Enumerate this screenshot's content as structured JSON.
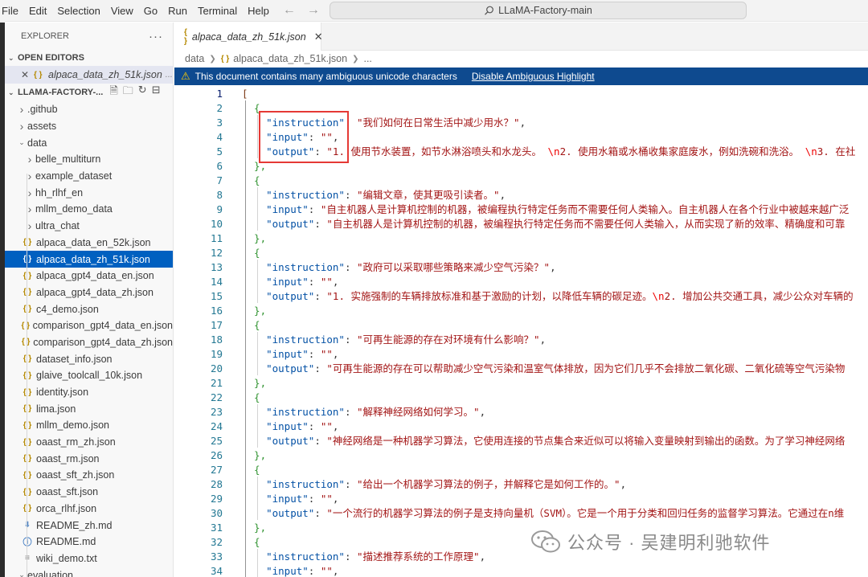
{
  "menu": [
    "File",
    "Edit",
    "Selection",
    "View",
    "Go",
    "Run",
    "Terminal",
    "Help"
  ],
  "command_center": "LLaMA-Factory-main",
  "explorer": {
    "title": "EXPLORER",
    "open_editors_label": "OPEN EDITORS",
    "open_editor": {
      "name": "alpaca_data_zh_51k.json",
      "path": "..."
    },
    "project_label": "LLAMA-FACTORY-...",
    "tree": [
      {
        "label": ".github",
        "kind": "folder",
        "level": 0
      },
      {
        "label": "assets",
        "kind": "folder",
        "level": 0
      },
      {
        "label": "data",
        "kind": "folder-open",
        "level": 0
      },
      {
        "label": "belle_multiturn",
        "kind": "folder",
        "level": 1
      },
      {
        "label": "example_dataset",
        "kind": "folder",
        "level": 1
      },
      {
        "label": "hh_rlhf_en",
        "kind": "folder",
        "level": 1
      },
      {
        "label": "mllm_demo_data",
        "kind": "folder",
        "level": 1
      },
      {
        "label": "ultra_chat",
        "kind": "folder",
        "level": 1
      },
      {
        "label": "alpaca_data_en_52k.json",
        "kind": "json",
        "level": 1
      },
      {
        "label": "alpaca_data_zh_51k.json",
        "kind": "json",
        "level": 1,
        "selected": true
      },
      {
        "label": "alpaca_gpt4_data_en.json",
        "kind": "json",
        "level": 1
      },
      {
        "label": "alpaca_gpt4_data_zh.json",
        "kind": "json",
        "level": 1
      },
      {
        "label": "c4_demo.json",
        "kind": "json",
        "level": 1
      },
      {
        "label": "comparison_gpt4_data_en.json",
        "kind": "json",
        "level": 1
      },
      {
        "label": "comparison_gpt4_data_zh.json",
        "kind": "json",
        "level": 1
      },
      {
        "label": "dataset_info.json",
        "kind": "json",
        "level": 1
      },
      {
        "label": "glaive_toolcall_10k.json",
        "kind": "json",
        "level": 1
      },
      {
        "label": "identity.json",
        "kind": "json",
        "level": 1
      },
      {
        "label": "lima.json",
        "kind": "json",
        "level": 1
      },
      {
        "label": "mllm_demo.json",
        "kind": "json",
        "level": 1
      },
      {
        "label": "oaast_rm_zh.json",
        "kind": "json",
        "level": 1
      },
      {
        "label": "oaast_rm.json",
        "kind": "json",
        "level": 1
      },
      {
        "label": "oaast_sft_zh.json",
        "kind": "json",
        "level": 1
      },
      {
        "label": "oaast_sft.json",
        "kind": "json",
        "level": 1
      },
      {
        "label": "orca_rlhf.json",
        "kind": "json",
        "level": 1
      },
      {
        "label": "README_zh.md",
        "kind": "md",
        "level": 1
      },
      {
        "label": "README.md",
        "kind": "info",
        "level": 1
      },
      {
        "label": "wiki_demo.txt",
        "kind": "txt",
        "level": 1
      },
      {
        "label": "evaluation",
        "kind": "folder-open",
        "level": 0
      }
    ]
  },
  "tab": {
    "name": "alpaca_data_zh_51k.json"
  },
  "breadcrumb": {
    "folder": "data",
    "file": "alpaca_data_zh_51k.json",
    "more": "..."
  },
  "banner": {
    "message": "This document contains many ambiguous unicode characters",
    "link": "Disable Ambiguous Highlight"
  },
  "code_lines": [
    {
      "n": "1",
      "parts": [
        [
          "brk2",
          "["
        ]
      ]
    },
    {
      "n": "2",
      "parts": [
        [
          "brk",
          "  {"
        ]
      ]
    },
    {
      "n": "3",
      "parts": [
        [
          "punc",
          "    "
        ],
        [
          "key",
          "\"instruction\""
        ],
        [
          "punc",
          ": "
        ],
        [
          "str",
          "\"我们如何在日常生活中减少用水？\""
        ],
        [
          "punc",
          ","
        ]
      ]
    },
    {
      "n": "4",
      "parts": [
        [
          "punc",
          "    "
        ],
        [
          "key",
          "\"input\""
        ],
        [
          "punc",
          ": "
        ],
        [
          "str",
          "\"\""
        ],
        [
          "punc",
          ","
        ]
      ]
    },
    {
      "n": "5",
      "parts": [
        [
          "punc",
          "    "
        ],
        [
          "key",
          "\"output\""
        ],
        [
          "punc",
          ": "
        ],
        [
          "str",
          "\"1. 使用节水装置，如节水淋浴喷头和水龙头。 "
        ],
        [
          "esc",
          "\\n"
        ],
        [
          "str",
          "2. 使用水箱或水桶收集家庭废水，例如洗碗和洗浴。 "
        ],
        [
          "esc",
          "\\n"
        ],
        [
          "str",
          "3. 在社"
        ]
      ]
    },
    {
      "n": "6",
      "parts": [
        [
          "brk",
          "  },"
        ]
      ]
    },
    {
      "n": "7",
      "parts": [
        [
          "brk",
          "  {"
        ]
      ]
    },
    {
      "n": "8",
      "parts": [
        [
          "punc",
          "    "
        ],
        [
          "key",
          "\"instruction\""
        ],
        [
          "punc",
          ": "
        ],
        [
          "str",
          "\"编辑文章，使其更吸引读者。\""
        ],
        [
          "punc",
          ","
        ]
      ]
    },
    {
      "n": "9",
      "parts": [
        [
          "punc",
          "    "
        ],
        [
          "key",
          "\"input\""
        ],
        [
          "punc",
          ": "
        ],
        [
          "str",
          "\"自主机器人是计算机控制的机器，被编程执行特定任务而不需要任何人类输入。自主机器人在各个行业中被越来越广泛"
        ]
      ]
    },
    {
      "n": "10",
      "parts": [
        [
          "punc",
          "    "
        ],
        [
          "key",
          "\"output\""
        ],
        [
          "punc",
          ": "
        ],
        [
          "str",
          "\"自主机器人是计算机控制的机器，被编程执行特定任务而不需要任何人类输入，从而实现了新的效率、精确度和可靠"
        ]
      ]
    },
    {
      "n": "11",
      "parts": [
        [
          "brk",
          "  },"
        ]
      ]
    },
    {
      "n": "12",
      "parts": [
        [
          "brk",
          "  {"
        ]
      ]
    },
    {
      "n": "13",
      "parts": [
        [
          "punc",
          "    "
        ],
        [
          "key",
          "\"instruction\""
        ],
        [
          "punc",
          ": "
        ],
        [
          "str",
          "\"政府可以采取哪些策略来减少空气污染？\""
        ],
        [
          "punc",
          ","
        ]
      ]
    },
    {
      "n": "14",
      "parts": [
        [
          "punc",
          "    "
        ],
        [
          "key",
          "\"input\""
        ],
        [
          "punc",
          ": "
        ],
        [
          "str",
          "\"\""
        ],
        [
          "punc",
          ","
        ]
      ]
    },
    {
      "n": "15",
      "parts": [
        [
          "punc",
          "    "
        ],
        [
          "key",
          "\"output\""
        ],
        [
          "punc",
          ": "
        ],
        [
          "str",
          "\"1. 实施强制的车辆排放标准和基于激励的计划，以降低车辆的碳足迹。"
        ],
        [
          "esc",
          "\\n"
        ],
        [
          "str",
          "2. 增加公共交通工具，减少公众对车辆的"
        ]
      ]
    },
    {
      "n": "16",
      "parts": [
        [
          "brk",
          "  },"
        ]
      ]
    },
    {
      "n": "17",
      "parts": [
        [
          "brk",
          "  {"
        ]
      ]
    },
    {
      "n": "18",
      "parts": [
        [
          "punc",
          "    "
        ],
        [
          "key",
          "\"instruction\""
        ],
        [
          "punc",
          ": "
        ],
        [
          "str",
          "\"可再生能源的存在对环境有什么影响？\""
        ],
        [
          "punc",
          ","
        ]
      ]
    },
    {
      "n": "19",
      "parts": [
        [
          "punc",
          "    "
        ],
        [
          "key",
          "\"input\""
        ],
        [
          "punc",
          ": "
        ],
        [
          "str",
          "\"\""
        ],
        [
          "punc",
          ","
        ]
      ]
    },
    {
      "n": "20",
      "parts": [
        [
          "punc",
          "    "
        ],
        [
          "key",
          "\"output\""
        ],
        [
          "punc",
          ": "
        ],
        [
          "str",
          "\"可再生能源的存在可以帮助减少空气污染和温室气体排放，因为它们几乎不会排放二氧化碳、二氧化硫等空气污染物"
        ]
      ]
    },
    {
      "n": "21",
      "parts": [
        [
          "brk",
          "  },"
        ]
      ]
    },
    {
      "n": "22",
      "parts": [
        [
          "brk",
          "  {"
        ]
      ]
    },
    {
      "n": "23",
      "parts": [
        [
          "punc",
          "    "
        ],
        [
          "key",
          "\"instruction\""
        ],
        [
          "punc",
          ": "
        ],
        [
          "str",
          "\"解释神经网络如何学习。\""
        ],
        [
          "punc",
          ","
        ]
      ]
    },
    {
      "n": "24",
      "parts": [
        [
          "punc",
          "    "
        ],
        [
          "key",
          "\"input\""
        ],
        [
          "punc",
          ": "
        ],
        [
          "str",
          "\"\""
        ],
        [
          "punc",
          ","
        ]
      ]
    },
    {
      "n": "25",
      "parts": [
        [
          "punc",
          "    "
        ],
        [
          "key",
          "\"output\""
        ],
        [
          "punc",
          ": "
        ],
        [
          "str",
          "\"神经网络是一种机器学习算法，它使用连接的节点集合来近似可以将输入变量映射到输出的函数。为了学习神经网络"
        ]
      ]
    },
    {
      "n": "26",
      "parts": [
        [
          "brk",
          "  },"
        ]
      ]
    },
    {
      "n": "27",
      "parts": [
        [
          "brk",
          "  {"
        ]
      ]
    },
    {
      "n": "28",
      "parts": [
        [
          "punc",
          "    "
        ],
        [
          "key",
          "\"instruction\""
        ],
        [
          "punc",
          ": "
        ],
        [
          "str",
          "\"给出一个机器学习算法的例子，并解释它是如何工作的。\""
        ],
        [
          "punc",
          ","
        ]
      ]
    },
    {
      "n": "29",
      "parts": [
        [
          "punc",
          "    "
        ],
        [
          "key",
          "\"input\""
        ],
        [
          "punc",
          ": "
        ],
        [
          "str",
          "\"\""
        ],
        [
          "punc",
          ","
        ]
      ]
    },
    {
      "n": "30",
      "parts": [
        [
          "punc",
          "    "
        ],
        [
          "key",
          "\"output\""
        ],
        [
          "punc",
          ": "
        ],
        [
          "str",
          "\"一个流行的机器学习算法的例子是支持向量机（SVM）。它是一个用于分类和回归任务的监督学习算法。它通过在n维"
        ]
      ]
    },
    {
      "n": "31",
      "parts": [
        [
          "brk",
          "  },"
        ]
      ]
    },
    {
      "n": "32",
      "parts": [
        [
          "brk",
          "  {"
        ]
      ]
    },
    {
      "n": "33",
      "parts": [
        [
          "punc",
          "    "
        ],
        [
          "key",
          "\"instruction\""
        ],
        [
          "punc",
          ": "
        ],
        [
          "str",
          "\"描述推荐系统的工作原理\""
        ],
        [
          "punc",
          ","
        ]
      ]
    },
    {
      "n": "34",
      "parts": [
        [
          "punc",
          "    "
        ],
        [
          "key",
          "\"input\""
        ],
        [
          "punc",
          ": "
        ],
        [
          "str",
          "\"\""
        ],
        [
          "punc",
          ","
        ]
      ]
    }
  ],
  "watermark": "公众号 · 吴建明利驰软件"
}
